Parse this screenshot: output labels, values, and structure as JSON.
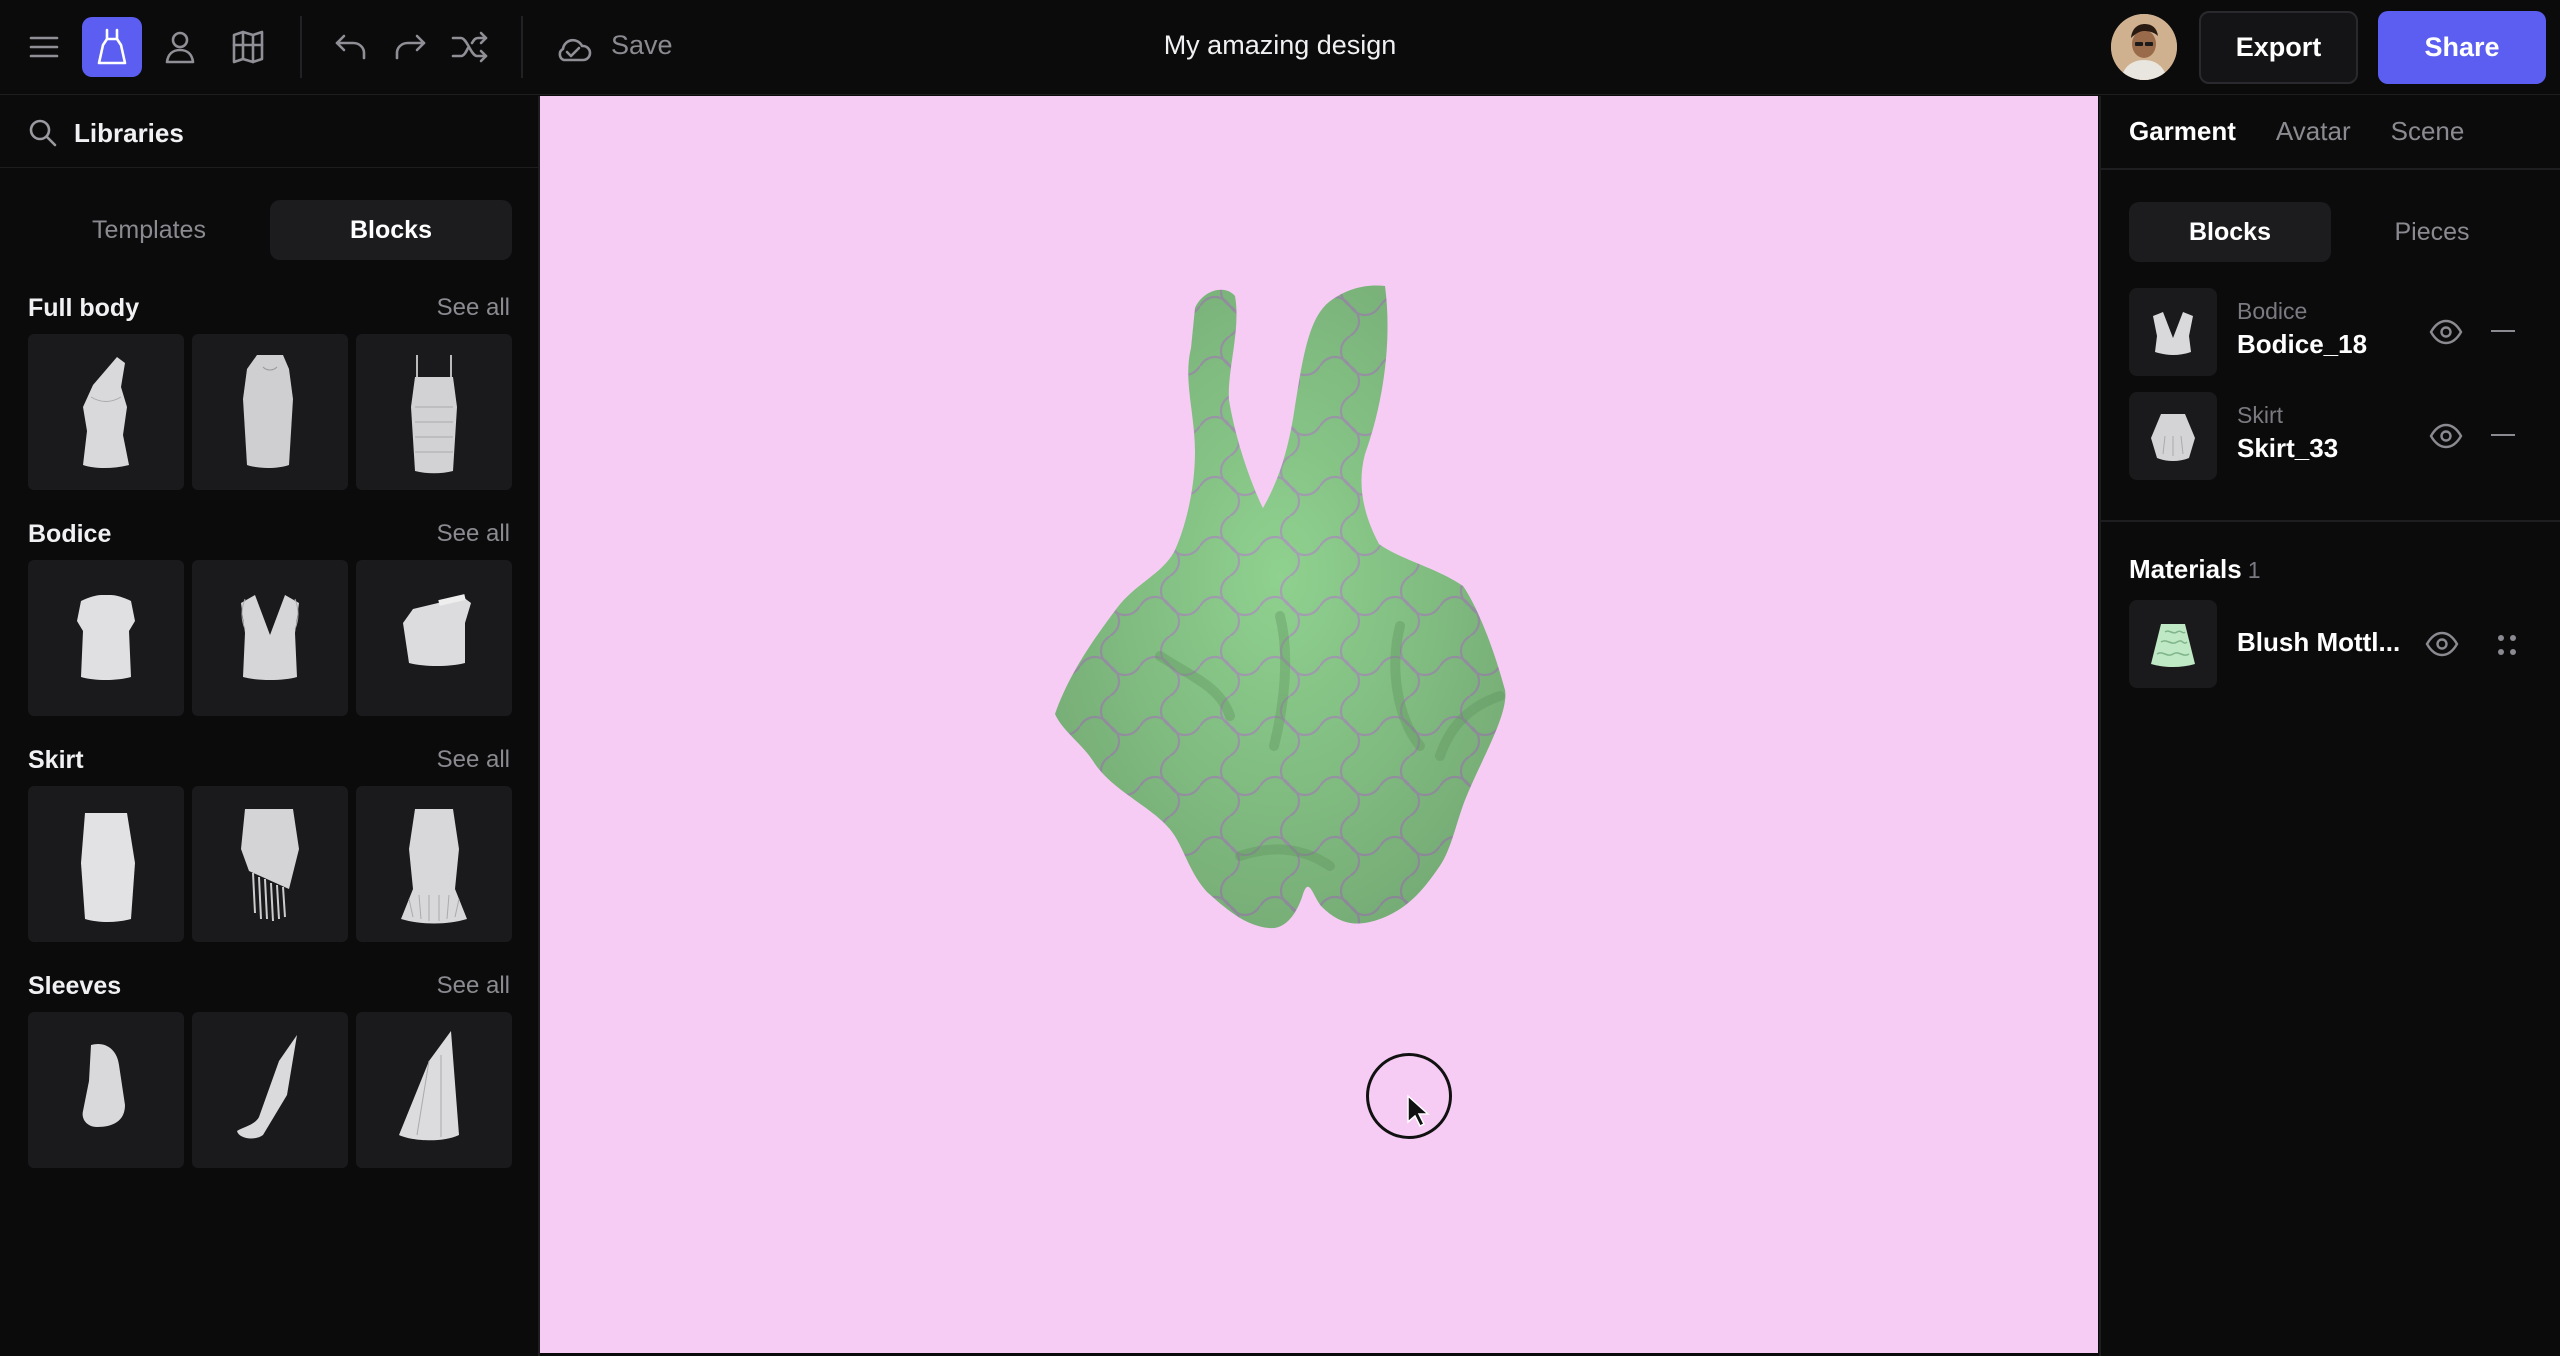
{
  "toolbar": {
    "save_label": "Save",
    "title": "My amazing design",
    "export_label": "Export",
    "share_label": "Share",
    "icons": [
      "menu-icon",
      "dress-icon",
      "avatar-icon",
      "pattern-icon",
      "undo-icon",
      "redo-icon",
      "shuffle-icon",
      "cloud-icon"
    ]
  },
  "left_panel": {
    "libraries_label": "Libraries",
    "tabs": [
      {
        "label": "Templates",
        "active": false
      },
      {
        "label": "Blocks",
        "active": true
      }
    ],
    "see_all_label": "See all",
    "sections": [
      {
        "title": "Full body",
        "see_all": "See all"
      },
      {
        "title": "Bodice",
        "see_all": "See all"
      },
      {
        "title": "Skirt",
        "see_all": "See all"
      },
      {
        "title": "Sleeves",
        "see_all": "See all"
      }
    ]
  },
  "right_panel": {
    "tabs": [
      {
        "label": "Garment",
        "active": true
      },
      {
        "label": "Avatar",
        "active": false
      },
      {
        "label": "Scene",
        "active": false
      }
    ],
    "segments": [
      {
        "label": "Blocks",
        "active": true
      },
      {
        "label": "Pieces",
        "active": false
      }
    ],
    "blocks": [
      {
        "category": "Bodice",
        "name": "Bodice_18"
      },
      {
        "category": "Skirt",
        "name": "Skirt_33"
      }
    ],
    "materials_title": "Materials",
    "materials_count": "1",
    "materials": [
      {
        "name": "Blush Mottl..."
      }
    ]
  },
  "colors": {
    "accent": "#5b5ef0",
    "viewport_bg": "#f6ccf4",
    "garment": "#8fd18f",
    "panel_bg": "#0b0b0c"
  }
}
